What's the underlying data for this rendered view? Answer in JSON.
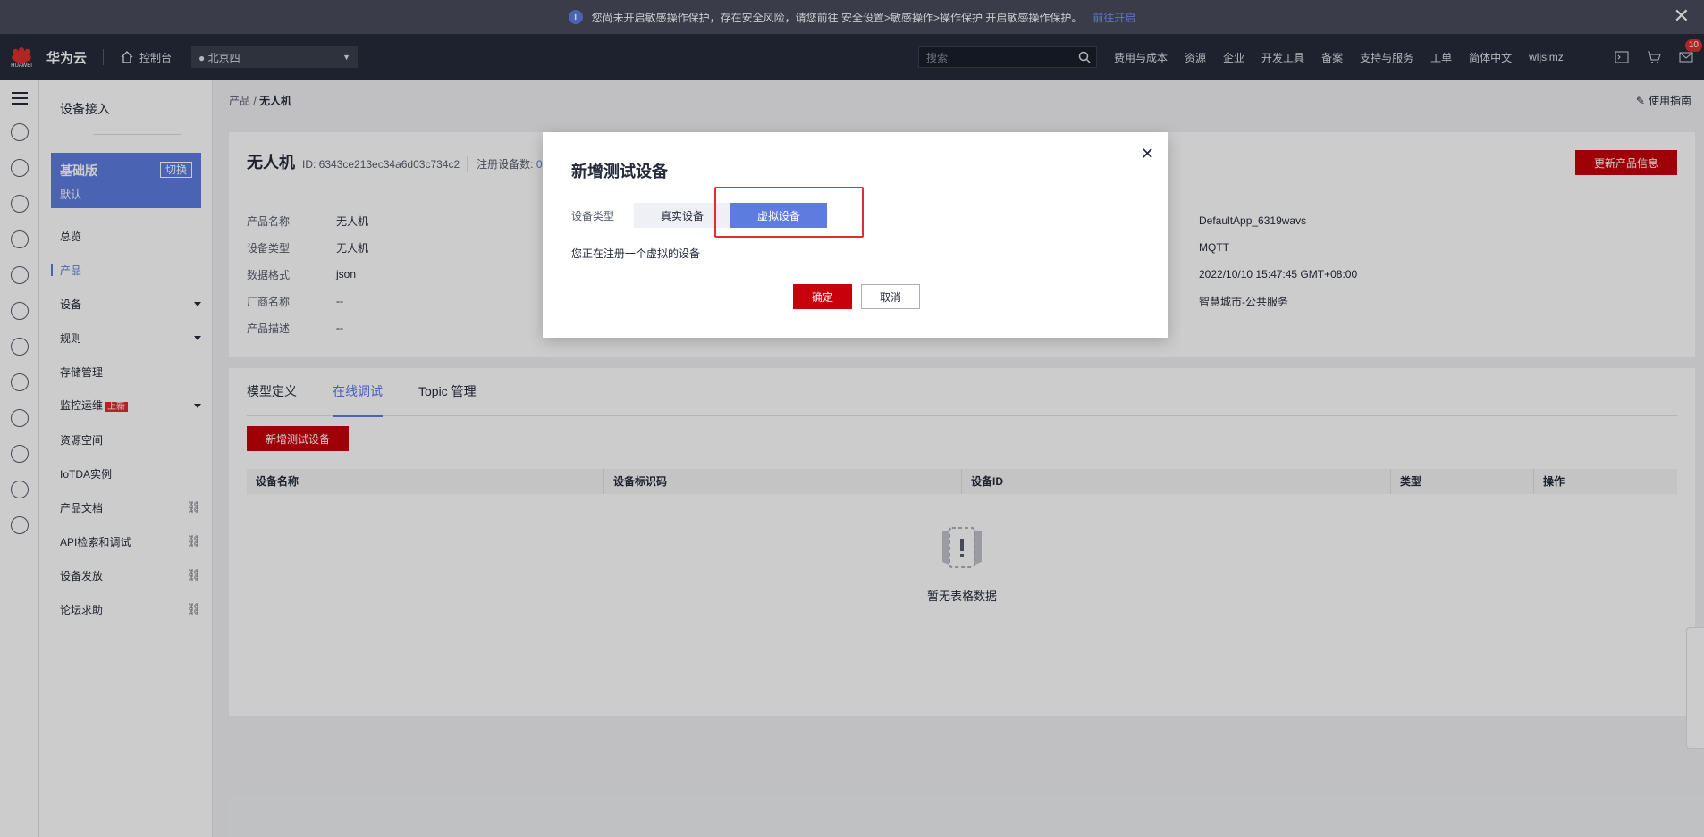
{
  "notice": {
    "text": "您尚未开启敏感操作保护，存在安全风险，请您前往 安全设置>敏感操作>操作保护 开启敏感操作保护。",
    "link": "前往开启"
  },
  "topnav": {
    "logo_text": "HUAWEI",
    "brand": "华为云",
    "console": "控制台",
    "region": "北京四",
    "search_placeholder": "搜索",
    "menu": [
      "费用与成本",
      "资源",
      "企业",
      "开发工具",
      "备案",
      "支持与服务",
      "工单",
      "简体中文",
      "wljslmz"
    ],
    "message_count": "10"
  },
  "sidebar": {
    "title": "设备接入",
    "edition": {
      "name": "基础版",
      "sub": "默认",
      "switch": "切换"
    },
    "items": [
      {
        "label": "总览"
      },
      {
        "label": "产品"
      },
      {
        "label": "设备"
      },
      {
        "label": "规则"
      },
      {
        "label": "存储管理"
      },
      {
        "label": "监控运维",
        "tag": "上新"
      },
      {
        "label": "资源空间"
      },
      {
        "label": "IoTDA实例"
      },
      {
        "label": "产品文档"
      },
      {
        "label": "API检索和调试"
      },
      {
        "label": "设备发放"
      },
      {
        "label": "论坛求助"
      }
    ]
  },
  "breadcrumb": {
    "parent": "产品",
    "current": "无人机"
  },
  "guide": "使用指南",
  "product": {
    "name": "无人机",
    "id": "ID: 6343ce213ec34a6d03c734c2",
    "count_label": "注册设备数:",
    "count": "0",
    "update_btn": "更新产品信息",
    "props": [
      {
        "k": "产品名称",
        "v": "无人机"
      },
      {
        "k": "设备类型",
        "v": "无人机"
      },
      {
        "k": "数据格式",
        "v": "json"
      },
      {
        "k": "厂商名称",
        "v": "--"
      },
      {
        "k": "产品描述",
        "v": "--"
      }
    ],
    "props_right": [
      {
        "v": "DefaultApp_6319wavs"
      },
      {
        "v": "MQTT"
      },
      {
        "v": "2022/10/10 15:47:45 GMT+08:00"
      },
      {
        "v": "智慧城市-公共服务"
      }
    ]
  },
  "tabs": [
    "模型定义",
    "在线调试",
    "Topic 管理"
  ],
  "add_test_device": "新增测试设备",
  "table": {
    "headers": [
      "设备名称",
      "设备标识码",
      "设备ID",
      "类型",
      "操作"
    ],
    "empty": "暂无表格数据"
  },
  "dialog": {
    "title": "新增测试设备",
    "type_label": "设备类型",
    "options": [
      "真实设备",
      "虚拟设备"
    ],
    "selected": "虚拟设备",
    "message": "您正在注册一个虚拟的设备",
    "ok": "确定",
    "cancel": "取消"
  },
  "colors": {
    "accent": "#5e7ce0",
    "brand_red": "#c7000b",
    "nav_bg": "#252b3a"
  }
}
